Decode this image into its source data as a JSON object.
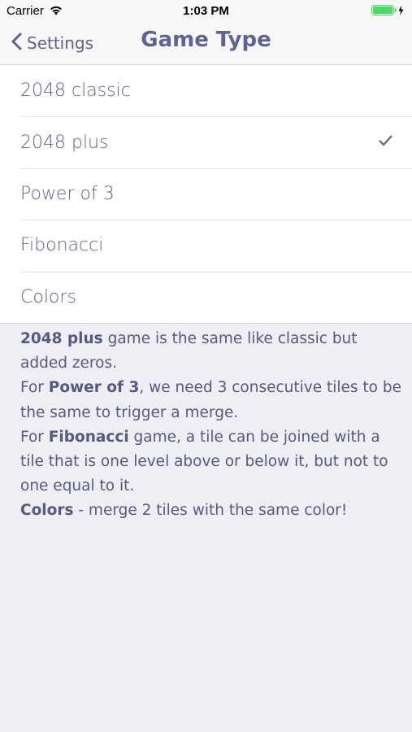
{
  "status_bar": {
    "carrier": "Carrier",
    "time": "1:03 PM",
    "wifi_icon": "wifi-icon",
    "battery_icon": "battery-charging-icon",
    "battery_color": "#4cd964"
  },
  "nav": {
    "back_label": "Settings",
    "title": "Game Type",
    "accent_color": "#5e6392"
  },
  "game_types": [
    {
      "label": "2048 classic",
      "selected": false
    },
    {
      "label": "2048 plus",
      "selected": true
    },
    {
      "label": "Power of 3",
      "selected": false
    },
    {
      "label": "Fibonacci",
      "selected": false
    },
    {
      "label": "Colors",
      "selected": false
    }
  ],
  "description": {
    "p1_bold": "2048 plus",
    "p1_text": " game is the same like classic but added zeros.",
    "p2_prefix": "For ",
    "p2_bold": "Power of 3",
    "p2_text": ", we need 3 consecutive tiles to be the same to trigger a merge.",
    "p3_prefix": "For ",
    "p3_bold": "Fibonacci",
    "p3_text": " game, a tile can be joined with a tile that is one level above or below it, but not to one equal to it.",
    "p4_bold": "Colors",
    "p4_text": " - merge 2 tiles with the same color!"
  }
}
